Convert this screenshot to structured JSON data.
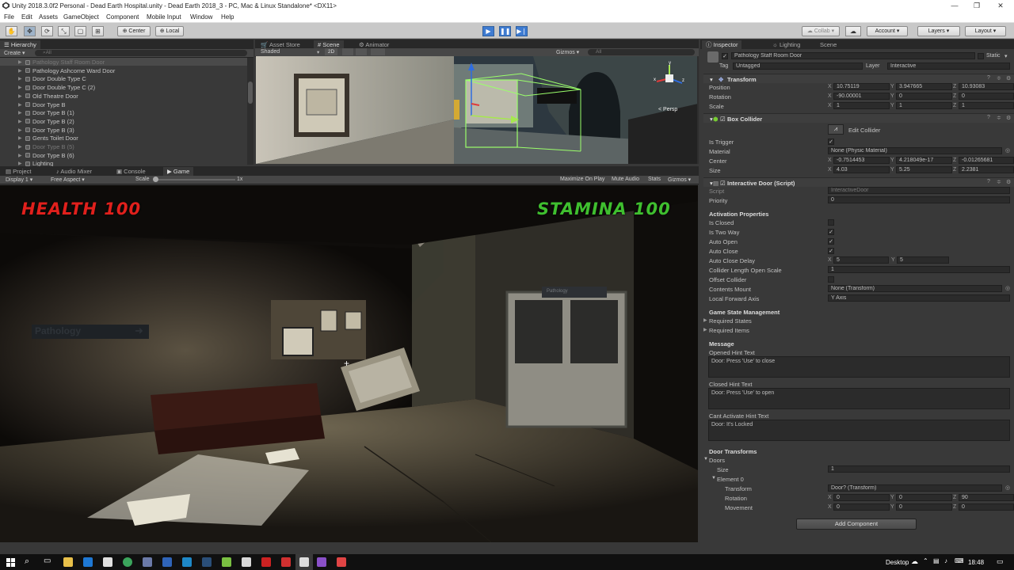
{
  "window": {
    "title": "Unity 2018.3.0f2 Personal - Dead Earth Hospital.unity - Dead Earth 2018_3 - PC, Mac & Linux Standalone* <DX11>"
  },
  "menu": [
    "File",
    "Edit",
    "Assets",
    "GameObject",
    "Component",
    "Mobile Input",
    "Window",
    "Help"
  ],
  "toolbar": {
    "pivot": "Center",
    "space": "Local",
    "collab": "Collab",
    "account": "Account",
    "layers": "Layers",
    "layout": "Layout"
  },
  "hierarchy": {
    "tab": "Hierarchy",
    "create": "Create",
    "search_placeholder": "All",
    "items": [
      {
        "label": "Pathology Staff Room Door",
        "selected": true
      },
      {
        "label": "Pathology Ashcome Ward Door"
      },
      {
        "label": "Door Double Type C"
      },
      {
        "label": "Door Double Type C (2)"
      },
      {
        "label": "Old Theatre Door"
      },
      {
        "label": "Door Type B"
      },
      {
        "label": "Door Type B (1)"
      },
      {
        "label": "Door Type B (2)"
      },
      {
        "label": "Door Type B (3)"
      },
      {
        "label": "Gents Toilet Door"
      },
      {
        "label": "Door Type B (5)",
        "dim": true
      },
      {
        "label": "Door Type B (6)"
      },
      {
        "label": "Lighting"
      }
    ]
  },
  "scene": {
    "tabs": [
      "Asset Store",
      "Scene",
      "Animator"
    ],
    "shading": "Shaded",
    "mode2d": "2D",
    "gizmos": "Gizmos",
    "search_placeholder": "All",
    "persp": "< Persp"
  },
  "bottom_tabs": [
    "Project",
    "Audio Mixer",
    "Console",
    "Game"
  ],
  "game": {
    "display": "Display 1",
    "aspect": "Free Aspect",
    "scale_label": "Scale",
    "scale_value": "1x",
    "maximize": "Maximize On Play",
    "mute": "Mute Audio",
    "stats": "Stats",
    "gizmos": "Gizmos",
    "health": "HEALTH 100",
    "stamina": "STAMINA 100",
    "sign1": "Pathology",
    "sign2": "Pathology"
  },
  "inspector": {
    "tabs": [
      "Inspector",
      "Lighting",
      "Scene"
    ],
    "object_name": "Pathology Staff Room Door",
    "static": "Static",
    "tag_label": "Tag",
    "tag": "Untagged",
    "layer_label": "Layer",
    "layer": "Interactive",
    "transform": {
      "title": "Transform",
      "position_label": "Position",
      "position": {
        "x": "10.75119",
        "y": "3.947665",
        "z": "10.93083"
      },
      "rotation_label": "Rotation",
      "rotation": {
        "x": "-90.00001",
        "y": "0",
        "z": "0"
      },
      "scale_label": "Scale",
      "scale": {
        "x": "1",
        "y": "1",
        "z": "1"
      }
    },
    "box_collider": {
      "title": "Box Collider",
      "edit": "Edit Collider",
      "is_trigger_label": "Is Trigger",
      "material_label": "Material",
      "material": "None (Physic Material)",
      "center_label": "Center",
      "center": {
        "x": "-0.7514453",
        "y": "4.218049e-17",
        "z": "-0.01265681"
      },
      "size_label": "Size",
      "size": {
        "x": "4.03",
        "y": "5.25",
        "z": "2.2381"
      }
    },
    "interactive_door": {
      "title": "Interactive Door (Script)",
      "script_label": "Script",
      "script": "InteractiveDoor",
      "priority_label": "Priority",
      "priority": "0",
      "activation_header": "Activation Properties",
      "is_closed": "Is Closed",
      "is_two_way": "Is Two Way",
      "auto_open": "Auto Open",
      "auto_close": "Auto Close",
      "auto_close_delay_label": "Auto Close Delay",
      "auto_close_delay": {
        "x": "5",
        "y": "5"
      },
      "collider_length_label": "Collider Length Open Scale",
      "collider_length": "1",
      "offset_collider": "Offset Collider",
      "contents_mount_label": "Contents Mount",
      "contents_mount": "None (Transform)",
      "local_forward_label": "Local Forward Axis",
      "local_forward": "Y Axis",
      "gsm_header": "Game State Management",
      "required_states": "Required States",
      "required_items": "Required Items",
      "message_header": "Message",
      "opened_label": "Opened Hint Text",
      "opened": "Door: Press 'Use' to close",
      "closed_label": "Closed Hint Text",
      "closed": "Door: Press 'Use' to open",
      "cant_label": "Cant Activate Hint Text",
      "cant": "Door: It's Locked",
      "transforms_header": "Door Transforms",
      "doors": "Doors",
      "size_label": "Size",
      "size": "1",
      "element0": "Element 0",
      "el_transform_label": "Transform",
      "el_transform": "Door? (Transform)",
      "el_rotation_label": "Rotation",
      "el_rotation": {
        "x": "0",
        "y": "0",
        "z": "90"
      },
      "el_movement_label": "Movement",
      "el_movement": {
        "x": "0",
        "y": "0",
        "z": "0"
      }
    },
    "add_component": "Add Component"
  },
  "taskbar": {
    "desktop": "Desktop",
    "time": "18:48"
  },
  "colors": {
    "health": "#e0201c",
    "stamina": "#3fbf2f",
    "play_blue": "#3e7bd1"
  }
}
